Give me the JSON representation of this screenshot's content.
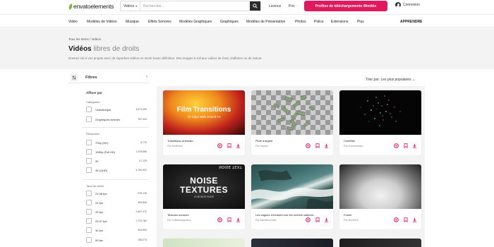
{
  "header": {
    "logo_text": "envatoelements",
    "search_category": "Vidéos",
    "search_placeholder": "Rechercher...",
    "links": [
      "Licence",
      "Prix"
    ],
    "cta_label": "Profitez de téléchargements illimités",
    "account_label": "Connexion"
  },
  "nav": {
    "items": [
      "Vidéo",
      "Modèles de Vidéos",
      "Musique",
      "Effets Sonores",
      "Modèles Graphiques",
      "Graphiques",
      "Modèles de Présentation",
      "Photos",
      "Police",
      "Extensions",
      "Plus"
    ],
    "learn": "APPRENDRE"
  },
  "hero": {
    "breadcrumb": "Tous les Items / Vidéos",
    "title_bold": "Vidéos",
    "title_light": "libres de droits",
    "description": "Donnez vie à vos projets avec de superbes vidéos en stock haute définition. Des images b-roll aux vidéos de fond, d'affaires ou de nature."
  },
  "sort_label": "Trier par: Les plus populaires",
  "sidebar": {
    "title": "Filtres",
    "refine": "Affiner par",
    "categories_heading": "Catégories",
    "categories": [
      {
        "label": "Vidéothèque",
        "count": "3,872,409"
      },
      {
        "label": "Graphiques Animés",
        "count": "787,004"
      }
    ],
    "resolution_heading": "Résolution",
    "resolutions": [
      {
        "label": "720p (HD)",
        "count": "8,775"
      },
      {
        "label": "1080p (Full HD)",
        "count": "1,678,656"
      },
      {
        "label": "2K",
        "count": "27,125"
      },
      {
        "label": "4K (UHD)",
        "count": "4,764,941"
      }
    ],
    "framerate_heading": "Taux de cadre",
    "framerates": [
      {
        "label": "23.98 fps",
        "count": "576,125"
      },
      {
        "label": "24 fps",
        "count": "455,808"
      },
      {
        "label": "25 fps",
        "count": "2,697,972"
      },
      {
        "label": "29.97 fps",
        "count": "1,723,782"
      },
      {
        "label": "30 fps",
        "count": "843,803"
      },
      {
        "label": "50 fps",
        "count": "156,074"
      }
    ]
  },
  "cards": [
    {
      "title": "Transitions cinémato",
      "author": "Par AvidEditor",
      "overlay_title": "Film Transitions",
      "overlay_sub": "20 Clips With Sound Fx"
    },
    {
      "title": "Pluie d'argent",
      "author": "Par requnic"
    },
    {
      "title": "Confettis",
      "author": "Par mohmedsaeo"
    },
    {
      "title": "Textures sonores",
      "author": "Par SolbibioArgentino",
      "overlay_title_1": "NOISE",
      "overlay_title_2": "TEXTURES",
      "overlay_sub": "6 HD MOV FILES",
      "overlay_mirror": "NOISE TEXT"
    },
    {
      "title": "Les vagues s'écrasent sur les rochers californi...",
      "author": "Par BlackBoxGuild"
    },
    {
      "title": "Fumer",
      "author": "Par Alex0016"
    }
  ],
  "colors": {
    "accent": "#e2185f",
    "brand_green": "#82b541",
    "hero_bg": "#f3f3f3"
  }
}
